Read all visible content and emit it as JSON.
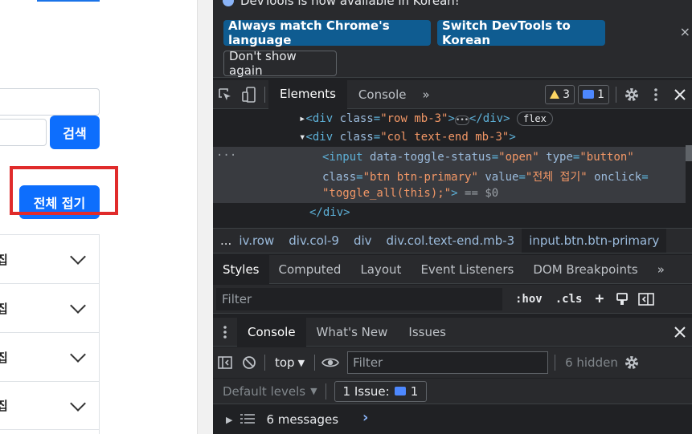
{
  "page": {
    "search_button": "검색",
    "collapse_button": "전체 접기",
    "rows": [
      "집",
      "집",
      "집",
      "집"
    ]
  },
  "devtools": {
    "infobar": {
      "message": "DevTools is now available in Korean!",
      "match_button": "Always match Chrome's language",
      "switch_button": "Switch DevTools to Korean",
      "dont_show_button": "Don't show again",
      "close": "×"
    },
    "tabs": {
      "elements": "Elements",
      "console": "Console",
      "more": "»",
      "warnings_count": "3",
      "messages_count": "1"
    },
    "code": {
      "line1_open": "<div",
      "line1_attr": "class",
      "line1_val": "\"row mb-3\"",
      "line1_close": "</div>",
      "flex_badge": "flex",
      "line2_open": "<div",
      "line2_attr": "class",
      "line2_val": "\"col text-end mb-3\"",
      "input_tag": "<input",
      "attr_toggle": "data-toggle-status",
      "val_toggle": "\"open\"",
      "attr_type": "type",
      "val_type": "\"button\"",
      "attr_class": "class",
      "val_class": "\"btn btn-primary\"",
      "attr_value": "value",
      "val_value": "\"전체 접기\"",
      "attr_onclick": "onclick",
      "val_onclick": "\"toggle_all(this);\"",
      "eq_ref": "== $0",
      "close_div": "</div>"
    },
    "breadcrumbs": [
      "...",
      "iv.row",
      "div.col-9",
      "div",
      "div.col.text-end.mb-3",
      "input.btn.btn-primary"
    ],
    "styles_tabs": [
      "Styles",
      "Computed",
      "Layout",
      "Event Listeners",
      "DOM Breakpoints",
      "»"
    ],
    "filter_placeholder": "Filter",
    "hov": ":hov",
    "cls": ".cls",
    "drawer_tabs": [
      "Console",
      "What's New",
      "Issues"
    ],
    "context": "top",
    "console_filter": "Filter",
    "hidden": "6 hidden",
    "default_levels": "Default levels",
    "issue_label": "1 Issue:",
    "issue_count": "1",
    "messages": "6 messages",
    "prompt": "›"
  }
}
